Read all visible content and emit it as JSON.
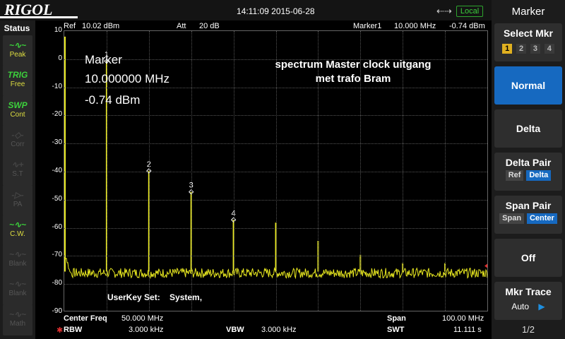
{
  "header": {
    "logo": "RIGOL",
    "datetime": "14:11:09 2015-06-28",
    "local_label": "Local",
    "usb_icon": "usb-icon"
  },
  "status_panel": {
    "title": "Status",
    "items": [
      {
        "icon": "~∿~",
        "label": "Peak",
        "dim": false
      },
      {
        "icon": "TRIG",
        "label": "Free",
        "dim": false
      },
      {
        "icon": "SWP",
        "label": "Cont",
        "dim": false
      },
      {
        "icon": "-◇-",
        "label": "Corr",
        "dim": true
      },
      {
        "icon": "∿+",
        "label": "S.T",
        "dim": true
      },
      {
        "icon": "-▷-",
        "label": "PA",
        "dim": true
      },
      {
        "icon": "~∿~",
        "label": "C.W.",
        "dim": false
      },
      {
        "icon": "~∿~",
        "label": "Blank",
        "dim": true
      },
      {
        "icon": "~∿~",
        "label": "Blank",
        "dim": true
      },
      {
        "icon": "~∿~",
        "label": "Math",
        "dim": true
      }
    ]
  },
  "display": {
    "ref_label": "Ref",
    "ref_value": "10.02 dBm",
    "att_label": "Att",
    "att_value": "20 dB",
    "marker_label": "Marker1",
    "marker_freq": "10.000 MHz",
    "marker_level": "-0.74 dBm",
    "marker_box": {
      "title": "Marker",
      "freq": "10.000000 MHz",
      "level": "-0.74 dBm"
    },
    "annotation_line1": "spectrum Master clock uitgang",
    "annotation_line2": "met trafo Bram",
    "userkey": "UserKey Set:    System,",
    "center_label": "Center Freq",
    "center_value": "50.000 MHz",
    "span_label": "Span",
    "span_value": "100.00 MHz",
    "rbw_label": "RBW",
    "rbw_value": "3.000 kHz",
    "vbw_label": "VBW",
    "vbw_value": "3.000 kHz",
    "swt_label": "SWT",
    "swt_value": "11.111 s"
  },
  "chart_data": {
    "type": "line",
    "x_unit": "MHz",
    "y_unit": "dBm",
    "xlim": [
      0,
      100
    ],
    "ylim": [
      -90,
      10
    ],
    "yticks": [
      "10",
      "0",
      "-10",
      "-20",
      "-30",
      "-40",
      "-50",
      "-60",
      "-70",
      "-80",
      "-90"
    ],
    "noise_floor": -76,
    "peaks": [
      {
        "x": 0,
        "y": 8,
        "label": ""
      },
      {
        "x": 10,
        "y": -0.74,
        "label": "1"
      },
      {
        "x": 20,
        "y": -40,
        "label": "2"
      },
      {
        "x": 30,
        "y": -47.5,
        "label": "3"
      },
      {
        "x": 40,
        "y": -57.5,
        "label": "4"
      },
      {
        "x": 50,
        "y": -58.5,
        "label": ""
      },
      {
        "x": 60,
        "y": -65,
        "label": ""
      },
      {
        "x": 70,
        "y": -70,
        "label": ""
      },
      {
        "x": 80,
        "y": -73,
        "label": ""
      },
      {
        "x": 90,
        "y": -73,
        "label": ""
      }
    ],
    "trace_color": "#e8e820"
  },
  "menu": {
    "title": "Marker",
    "select_mkr": "Select Mkr",
    "mkr_numbers": [
      "1",
      "2",
      "3",
      "4"
    ],
    "normal": "Normal",
    "delta": "Delta",
    "delta_pair": "Delta Pair",
    "delta_pair_ref": "Ref",
    "delta_pair_delta": "Delta",
    "span_pair": "Span Pair",
    "span_pair_span": "Span",
    "span_pair_center": "Center",
    "off": "Off",
    "mkr_trace": "Mkr Trace",
    "mkr_trace_value": "Auto",
    "page": "1/2"
  }
}
